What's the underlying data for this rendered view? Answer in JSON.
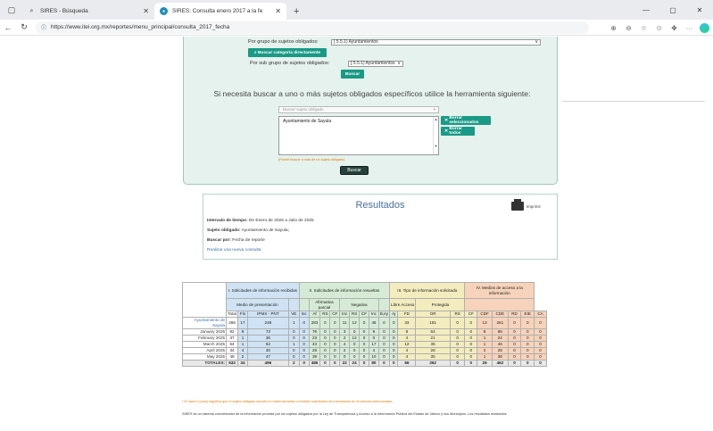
{
  "browser": {
    "tabs": [
      {
        "title": "SIRES - Búsqueda"
      },
      {
        "title": "SIRES: Consulta enero 2017 a la fe"
      }
    ],
    "url": "https://www.itei.org.mx/reportes/menu_principal/consulta_2017_fecha"
  },
  "search": {
    "group_label": "Por grupo de sujetos obligados:",
    "group_value": "[ 5.5.1) Ayuntamientos",
    "btn_category": "Buscar categoría directamente",
    "subgroup_label": "Por sub grupo de sujetos obligados:",
    "subgroup_value": "[ 5.5.1) Ayuntamientos",
    "btn_search_small": "Buscar",
    "info": "Si necesita buscar a uno o más sujetos obligados específicos utilice la herramienta siguiente:",
    "picker_placeholder": "Buscar sujeto obligado",
    "selected_item": "Ayuntamiento de Sayula",
    "btn_delete_selected": "Borrar seleccionados",
    "btn_delete_all": "Borrar todos",
    "hint": "(Puede buscar a más de un sujeto obligado)",
    "btn_search": "Buscar"
  },
  "results": {
    "title": "Resultados",
    "print_label": "Imprimir",
    "interval_label": "Intervalo de tiempo:",
    "interval_value": "De Enero de 2025 a Julio de 2025",
    "subject_label": "Sujeto obligado:",
    "subject_value": "Ayuntamiento de Sayula;",
    "search_by_label": "Buscar por:",
    "search_by_value": "Fecha de reporte",
    "new_query_link": "Realizar una nueva consulta"
  },
  "table": {
    "group_headers": {
      "g1": "I. Solicitudes de información recibidas",
      "g2": "II. Solicitudes de información resueltas",
      "g3": "III. Tipo de información solicitada",
      "g4": "IV. Medios de acceso a la información"
    },
    "sub_headers": {
      "medio": "Medio de presentación",
      "afirm": "Afirmativa parcial",
      "neg": "Negativa",
      "libre": "Libre Acceso",
      "prot": "Protegida"
    },
    "columns": [
      "Total",
      "Fis",
      "IPMX - PNT",
      "VE",
      "Inc",
      "Af",
      "RS",
      "CF",
      "Inc",
      "RS",
      "CF",
      "Inc",
      "B,ey",
      "Aj",
      "FD",
      "OR",
      "RS",
      "CF",
      "CDF",
      "CDE",
      "RD",
      "EIE",
      "CA"
    ],
    "rows": [
      {
        "label": "Ayuntamiento de Sayula",
        "cells": [
          "266",
          "17",
          "248",
          "1",
          "0",
          "283",
          "0",
          "0",
          "11",
          "12",
          "0",
          "48",
          "0",
          "0",
          "33",
          "181",
          "0",
          "0",
          "13",
          "261",
          "0",
          "0",
          "0"
        ]
      },
      {
        "label": "January 2025",
        "cells": [
          "82",
          "9",
          "73",
          "0",
          "0",
          "76",
          "0",
          "0",
          "3",
          "0",
          "0",
          "9",
          "0",
          "0",
          "9",
          "64",
          "0",
          "0",
          "8",
          "65",
          "0",
          "0",
          "0"
        ]
      },
      {
        "label": "February 2025",
        "cells": [
          "37",
          "1",
          "36",
          "0",
          "0",
          "23",
          "0",
          "0",
          "2",
          "12",
          "0",
          "0",
          "0",
          "0",
          "4",
          "21",
          "0",
          "0",
          "1",
          "24",
          "0",
          "0",
          "0"
        ]
      },
      {
        "label": "March 2025",
        "cells": [
          "64",
          "1",
          "62",
          "1",
          "0",
          "43",
          "0",
          "0",
          "4",
          "0",
          "0",
          "17",
          "0",
          "0",
          "12",
          "35",
          "0",
          "0",
          "1",
          "46",
          "0",
          "0",
          "0"
        ]
      },
      {
        "label": "April 2025",
        "cells": [
          "34",
          "4",
          "30",
          "0",
          "0",
          "28",
          "0",
          "0",
          "2",
          "0",
          "0",
          "4",
          "0",
          "0",
          "4",
          "26",
          "0",
          "0",
          "2",
          "28",
          "0",
          "0",
          "0"
        ]
      },
      {
        "label": "May 2025",
        "cells": [
          "49",
          "2",
          "47",
          "0",
          "0",
          "39",
          "0",
          "0",
          "0",
          "0",
          "0",
          "10",
          "0",
          "0",
          "4",
          "35",
          "0",
          "0",
          "1",
          "38",
          "0",
          "0",
          "0"
        ]
      }
    ],
    "totals": {
      "label": "TOTALES:",
      "cells": [
        "532",
        "34",
        "496",
        "2",
        "0",
        "486",
        "0",
        "0",
        "22",
        "24",
        "0",
        "80",
        "0",
        "0",
        "66",
        "362",
        "0",
        "0",
        "26",
        "462",
        "0",
        "0",
        "0"
      ]
    }
  },
  "footnote": "* El valor 0 (cero) significa que el sujeto obligado reportó no haber atendido o recibido solicitudes de información en el periodo seleccionado.",
  "bottom_text": "SIRES es un sistema concentrador de la información provista por los sujetos obligados por la Ley de Transparencia y Acceso a la Información Pública del Estado de Jalisco y sus Municipios. Los resultados mostrados"
}
